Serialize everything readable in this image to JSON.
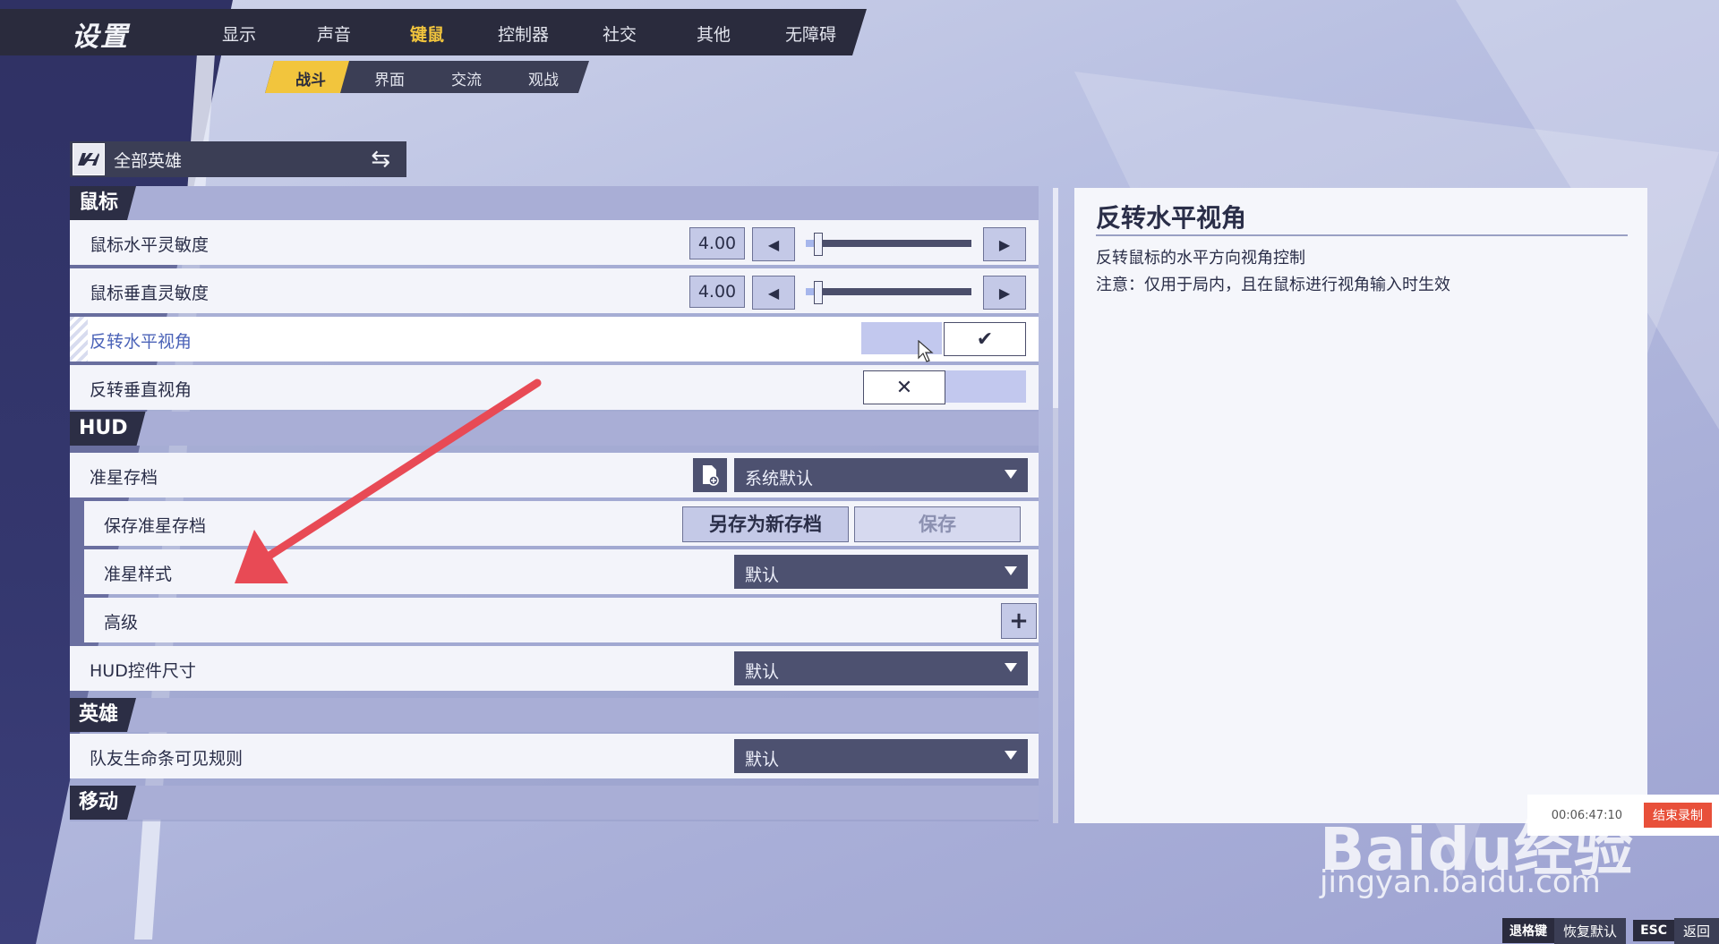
{
  "header": {
    "title": "设置",
    "tabs": [
      "显示",
      "声音",
      "键鼠",
      "控制器",
      "社交",
      "其他",
      "无障碍"
    ],
    "active_tab": "键鼠"
  },
  "subnav": {
    "tabs": [
      "战斗",
      "界面",
      "交流",
      "观战"
    ],
    "active_tab": "战斗"
  },
  "hero_select": {
    "label": "全部英雄"
  },
  "sections": {
    "mouse": "鼠标",
    "hud": "HUD",
    "hero": "英雄",
    "move": "移动"
  },
  "settings": {
    "mouse_h_sens": {
      "label": "鼠标水平灵敏度",
      "value": "4.00",
      "level": 0.05
    },
    "mouse_v_sens": {
      "label": "鼠标垂直灵敏度",
      "value": "4.00",
      "level": 0.05
    },
    "invert_h": {
      "label": "反转水平视角",
      "state": "on"
    },
    "invert_v": {
      "label": "反转垂直视角",
      "state": "off"
    },
    "crosshair_profile": {
      "label": "准星存档",
      "value": "系统默认"
    },
    "save_crosshair": {
      "label": "保存准星存档",
      "save_as_new": "另存为新存档",
      "save": "保存"
    },
    "crosshair_style": {
      "label": "准星样式",
      "value": "默认"
    },
    "advanced": {
      "label": "高级"
    },
    "hud_size": {
      "label": "HUD控件尺寸",
      "value": "默认"
    },
    "ally_health": {
      "label": "队友生命条可见规则",
      "value": "默认"
    }
  },
  "description": {
    "title": "反转水平视角",
    "line1": "反转鼠标的水平方向视角控制",
    "line2": "注意：仅用于局内，且在鼠标进行视角输入时生效"
  },
  "recorder": {
    "time": "00:06:47:10",
    "stop": "结束录制"
  },
  "watermark": {
    "brand": "Baidu经验",
    "url": "jingyan.baidu.com"
  },
  "footer": {
    "key1": "退格键",
    "label1": "恢复默认",
    "key2": "ESC",
    "label2": "返回"
  },
  "colors": {
    "accent": "#f2c53d",
    "panel_dark": "#2c2e45",
    "highlight_text": "#4b63b8",
    "annotation": "#e84a55"
  }
}
